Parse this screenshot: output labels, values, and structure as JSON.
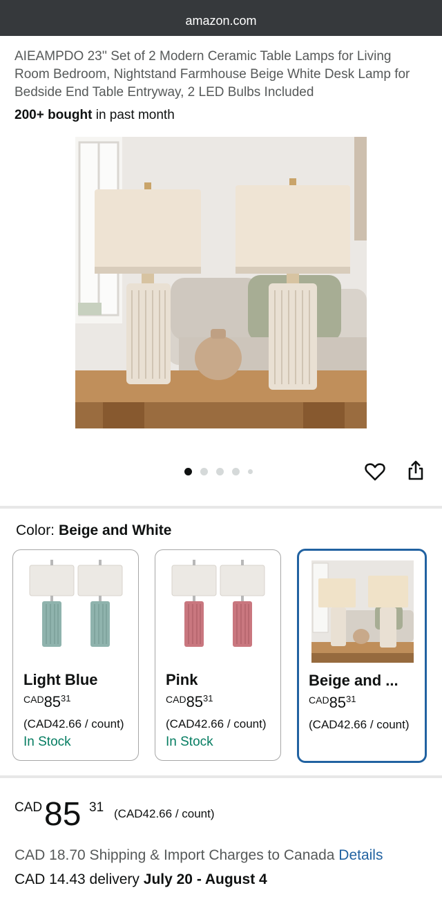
{
  "browser": {
    "url": "amazon.com"
  },
  "product": {
    "title": "AIEAMPDO 23'' Set of 2 Modern Ceramic Table Lamps for Living Room Bedroom, Nightstand Farmhouse Beige White Desk Lamp for Bedside End Table Entryway, 2 LED Bulbs Included",
    "bought_bold": "200+ bought",
    "bought_rest": " in past month"
  },
  "gallery": {
    "image_count": 5,
    "active_index": 0
  },
  "icons": {
    "favorite": "heart-icon",
    "share": "share-icon"
  },
  "color_selector": {
    "label": "Color:",
    "selected_value": "Beige and White",
    "options": [
      {
        "name": "Light Blue",
        "currency": "CAD",
        "whole": "85",
        "cents": "31",
        "unit_price": "(CAD42.66 / count)",
        "stock": "In Stock",
        "color": "#8fb3ad"
      },
      {
        "name": "Pink",
        "currency": "CAD",
        "whole": "85",
        "cents": "31",
        "unit_price": "(CAD42.66 / count)",
        "stock": "In Stock",
        "color": "#c9777f"
      },
      {
        "name": "Beige and ...",
        "currency": "CAD",
        "whole": "85",
        "cents": "31",
        "unit_price": "(CAD42.66 / count)",
        "stock": "",
        "color": "#e8e0d4"
      }
    ]
  },
  "price": {
    "currency": "CAD",
    "whole": "85",
    "cents": "31",
    "unit_price": "(CAD42.66 / count)"
  },
  "shipping": {
    "text": "CAD 18.70 Shipping & Import Charges to Canada ",
    "link": "Details"
  },
  "delivery": {
    "prefix": "CAD 14.43 delivery ",
    "dates": "July 20 - August 4"
  },
  "colors": {
    "accent_blue": "#2162a1",
    "stock_green": "#067d62",
    "topbar": "#36393c"
  }
}
